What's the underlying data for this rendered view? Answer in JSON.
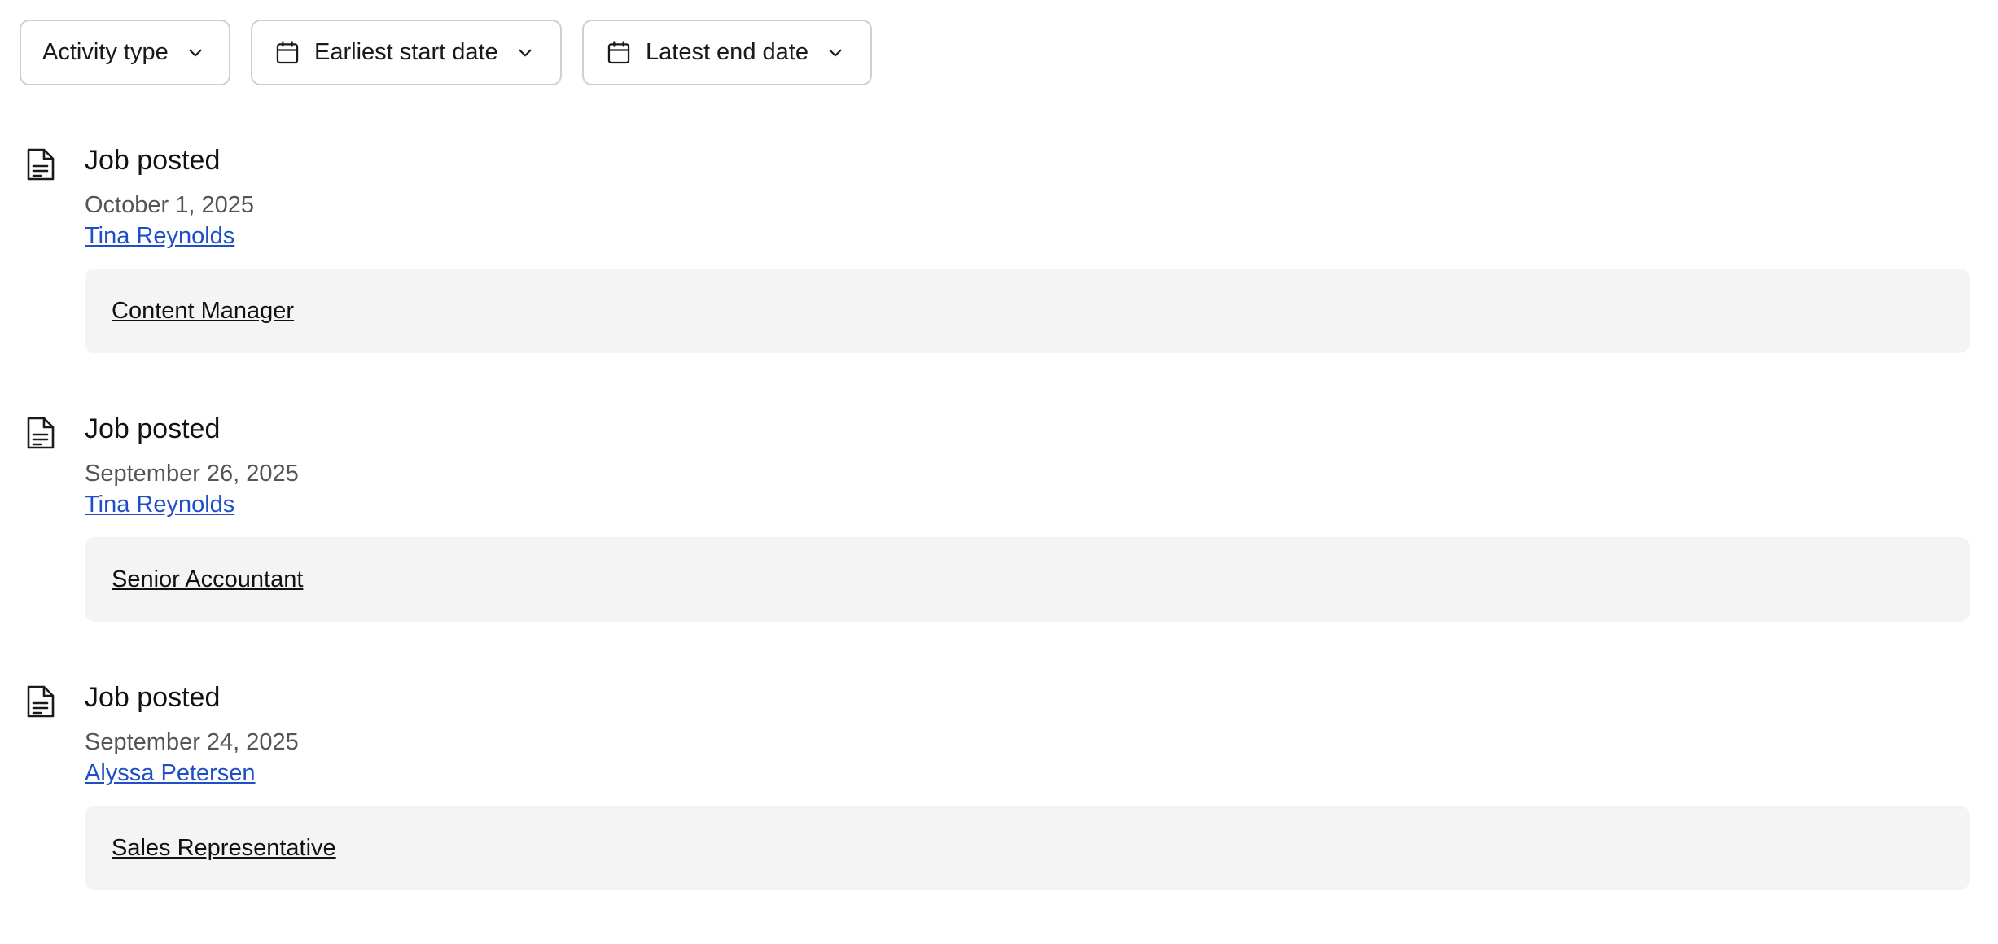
{
  "filters": {
    "activity_type": "Activity type",
    "earliest_start": "Earliest start date",
    "latest_end": "Latest end date"
  },
  "icons": {
    "activity": "document-icon",
    "date_filter": "calendar-icon",
    "dropdown": "chevron-down-icon"
  },
  "colors": {
    "link": "#1f4ec7",
    "card_bg": "#f4f4f4",
    "border": "#cfcfcf"
  },
  "activities": [
    {
      "title": "Job posted",
      "date": "October 1, 2025",
      "user": "Tina Reynolds",
      "job": "Content Manager"
    },
    {
      "title": "Job posted",
      "date": "September 26, 2025",
      "user": "Tina Reynolds",
      "job": "Senior Accountant"
    },
    {
      "title": "Job posted",
      "date": "September 24, 2025",
      "user": "Alyssa Petersen",
      "job": "Sales Representative"
    }
  ]
}
